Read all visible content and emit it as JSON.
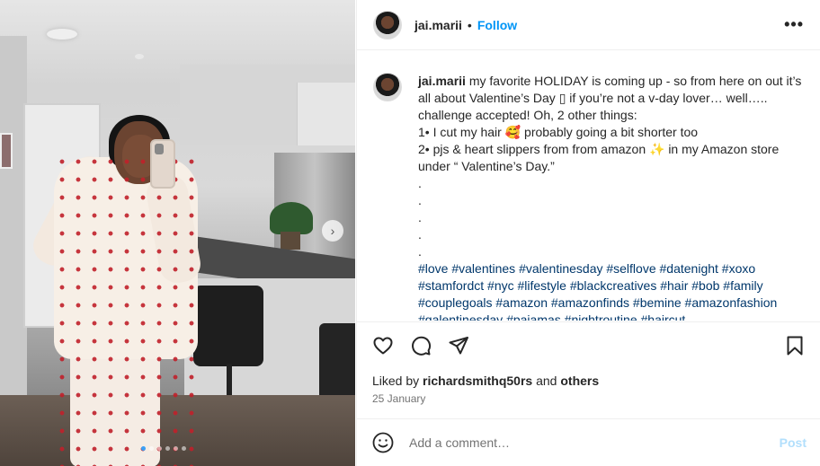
{
  "post": {
    "username": "jai.marii",
    "separator": "•",
    "follow_label": "Follow",
    "more_label": "•••"
  },
  "caption": {
    "username": "jai.marii",
    "lines": [
      "my favorite HOLIDAY is coming up - so from here on out it’s all about Valentine’s Day ▯ if you’re not a v-day lover… well….. challenge accepted! Oh, 2 other things:",
      "1• I cut my hair 🥰 probably going a bit shorter too",
      "2• pjs & heart slippers from from amazon ✨ in my Amazon store under “ Valentine’s Day.”",
      ".",
      ".",
      ".",
      ".",
      "."
    ],
    "hashtags": "#love #valentines #valentinesday #selflove #datenight #xoxo #stamfordct #nyc #lifestyle #blackcreatives #hair #bob #family #couplegoals #amazon #amazonfinds #bemine #amazonfashion #galentinesday #pajamas #nightroutine #haircut"
  },
  "likes": {
    "prefix": "Liked by",
    "user": "richardsmithq50rs",
    "middle": "and",
    "others": "others"
  },
  "date": "25 January",
  "comment": {
    "placeholder": "Add a comment…",
    "post_label": "Post"
  },
  "carousel": {
    "total_dots": 6,
    "active_index": 0,
    "next_label": "›"
  },
  "icons": {
    "like": "heart-icon",
    "comment": "comment-icon",
    "share": "share-icon",
    "save": "bookmark-icon",
    "emoji": "emoji-icon"
  },
  "colors": {
    "accent": "#0095f6",
    "hashtag": "#00376b",
    "post_disabled": "#b2dffc"
  }
}
